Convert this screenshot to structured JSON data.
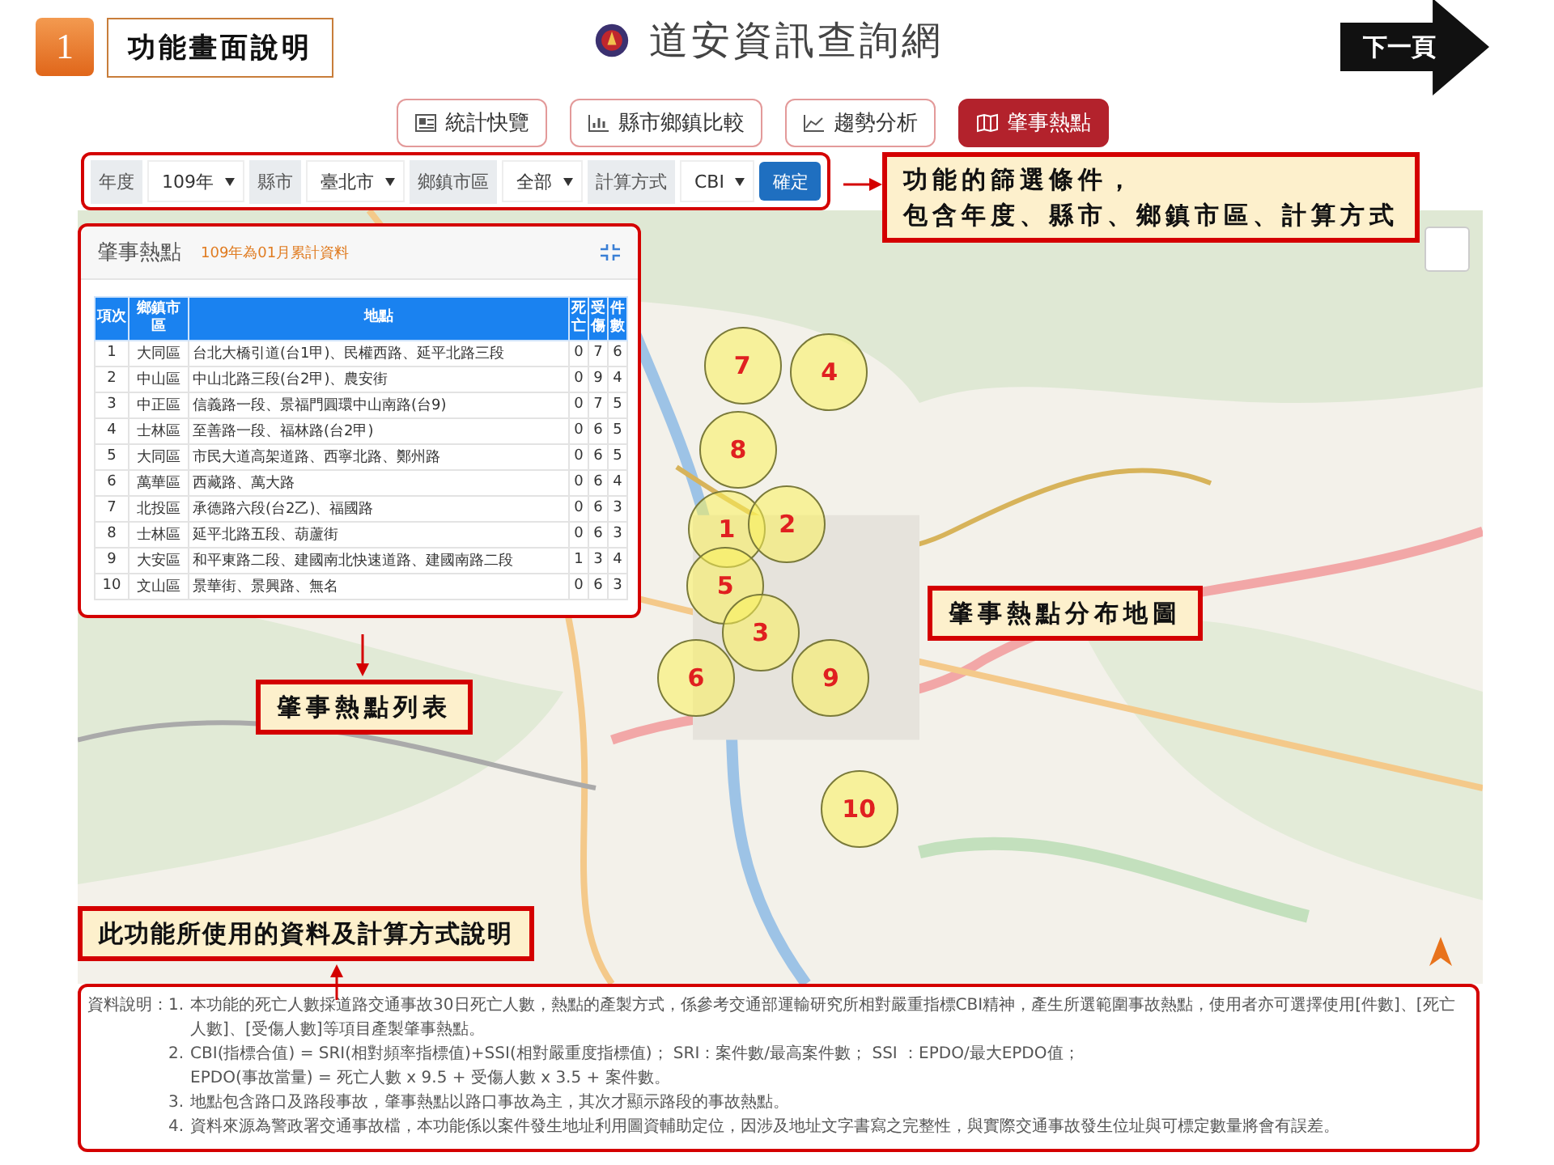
{
  "slide": {
    "step": "1",
    "title": "功能畫面說明",
    "next": "下一頁"
  },
  "site": {
    "title": "道安資訊查詢網"
  },
  "nav": [
    {
      "label": "統計快覽",
      "selected": false
    },
    {
      "label": "縣市鄉鎮比較",
      "selected": false
    },
    {
      "label": "趨勢分析",
      "selected": false
    },
    {
      "label": "肇事熱點",
      "selected": true
    }
  ],
  "filters": [
    {
      "label": "年度",
      "value": "109年"
    },
    {
      "label": "縣市",
      "value": "臺北市"
    },
    {
      "label": "鄉鎮市區",
      "value": "全部"
    },
    {
      "label": "計算方式",
      "value": "CBI"
    }
  ],
  "confirm": "確定",
  "panel": {
    "title": "肇事熱點",
    "subtitle": "109年為01月累計資料",
    "columns": [
      "項次",
      "鄉鎮市區",
      "地點",
      "死亡",
      "受傷",
      "件數"
    ],
    "rows": [
      [
        "1",
        "大同區",
        "台北大橋引道(台1甲)、民權西路、延平北路三段",
        "0",
        "7",
        "6"
      ],
      [
        "2",
        "中山區",
        "中山北路三段(台2甲)、農安街",
        "0",
        "9",
        "4"
      ],
      [
        "3",
        "中正區",
        "信義路一段、景福門圓環中山南路(台9)",
        "0",
        "7",
        "5"
      ],
      [
        "4",
        "士林區",
        "至善路一段、福林路(台2甲)",
        "0",
        "6",
        "5"
      ],
      [
        "5",
        "大同區",
        "市民大道高架道路、西寧北路、鄭州路",
        "0",
        "6",
        "5"
      ],
      [
        "6",
        "萬華區",
        "西藏路、萬大路",
        "0",
        "6",
        "4"
      ],
      [
        "7",
        "北投區",
        "承德路六段(台2乙)、福國路",
        "0",
        "6",
        "3"
      ],
      [
        "8",
        "士林區",
        "延平北路五段、葫蘆街",
        "0",
        "6",
        "3"
      ],
      [
        "9",
        "大安區",
        "和平東路二段、建國南北快速道路、建國南路二段",
        "1",
        "3",
        "4"
      ],
      [
        "10",
        "文山區",
        "景華街、景興路、無名",
        "0",
        "6",
        "3"
      ]
    ]
  },
  "hotspots": [
    {
      "label": "7"
    },
    {
      "label": "4"
    },
    {
      "label": "8"
    },
    {
      "label": "1"
    },
    {
      "label": "2"
    },
    {
      "label": "5"
    },
    {
      "label": "3"
    },
    {
      "label": "6"
    },
    {
      "label": "9"
    },
    {
      "label": "10"
    }
  ],
  "callouts": [
    {
      "kind": "filters",
      "lines": [
        "功能的篩選條件，",
        "包含年度、縣市、鄉鎮市區、計算方式"
      ]
    },
    {
      "kind": "table",
      "lines": [
        "肇事熱點列表"
      ]
    },
    {
      "kind": "map",
      "lines": [
        "肇事熱點分布地圖"
      ]
    },
    {
      "kind": "notes",
      "lines": [
        "此功能所使用的資料及計算方式說明"
      ]
    }
  ],
  "notes": {
    "label": "資料說明：",
    "items": [
      {
        "num": "1.",
        "lines": [
          "本功能的死亡人數採道路交通事故30日死亡人數，熱點的產製方式，係參考交通部運輸研究所相對嚴重指標CBI精神，產生所選範圍事故熱點，使用者亦可選擇使用[件數]、[死亡人數]、[受傷人數]等項目產製肇事熱點。"
        ]
      },
      {
        "num": "2.",
        "lines": [
          "CBI(指標合值) = SRI(相對頻率指標值)+SSI(相對嚴重度指標值)； SRI：案件數/最高案件數； SSI ：EPDO/最大EPDO值；",
          "EPDO(事故當量) = 死亡人數 x 9.5 + 受傷人數 x 3.5 + 案件數。"
        ]
      },
      {
        "num": "3.",
        "lines": [
          "地點包含路口及路段事故，肇事熱點以路口事故為主，其次才顯示路段的事故熱點。"
        ]
      },
      {
        "num": "4.",
        "lines": [
          "資料來源為警政署交通事故檔，本功能係以案件發生地址利用圖資輔助定位，因涉及地址文字書寫之完整性，與實際交通事故發生位址與可標定數量將會有誤差。"
        ]
      }
    ]
  }
}
